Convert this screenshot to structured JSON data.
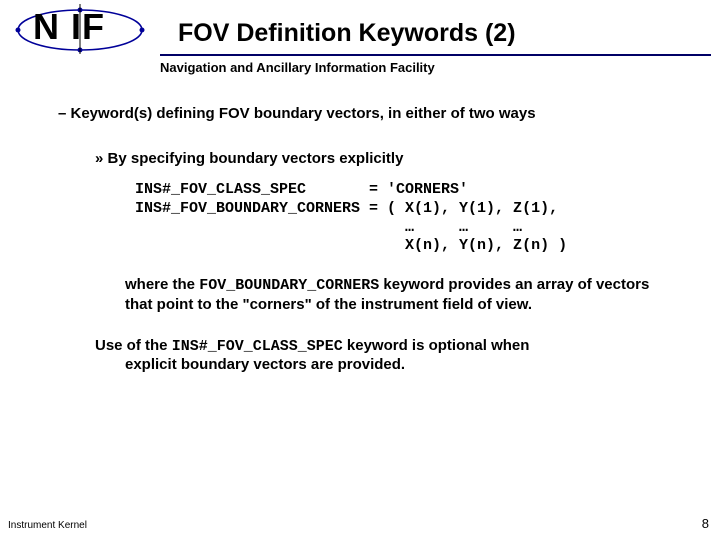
{
  "logo_text": "N  IF",
  "title": "FOV Definition Keywords (2)",
  "subtitle": "Navigation and Ancillary Information Facility",
  "bullet1": "–  Keyword(s) defining FOV boundary vectors, in either of two ways",
  "bullet2": "»  By specifying boundary vectors explicitly",
  "code": "INS#_FOV_CLASS_SPEC       = 'CORNERS'\nINS#_FOV_BOUNDARY_CORNERS = ( X(1), Y(1), Z(1),\n                              …     …     …\n                              X(n), Y(n), Z(n) )",
  "para1_a": "where the ",
  "para1_code": "FOV_BOUNDARY_CORNERS",
  "para1_b": " keyword provides an array of vectors that point to the \"corners\" of the instrument field of view.",
  "para2_a": "Use of the ",
  "para2_code": "INS#_FOV_CLASS_SPEC",
  "para2_b": " keyword is optional when",
  "para2_c": "explicit boundary vectors are provided.",
  "footer_left": "Instrument Kernel",
  "footer_right": "8"
}
